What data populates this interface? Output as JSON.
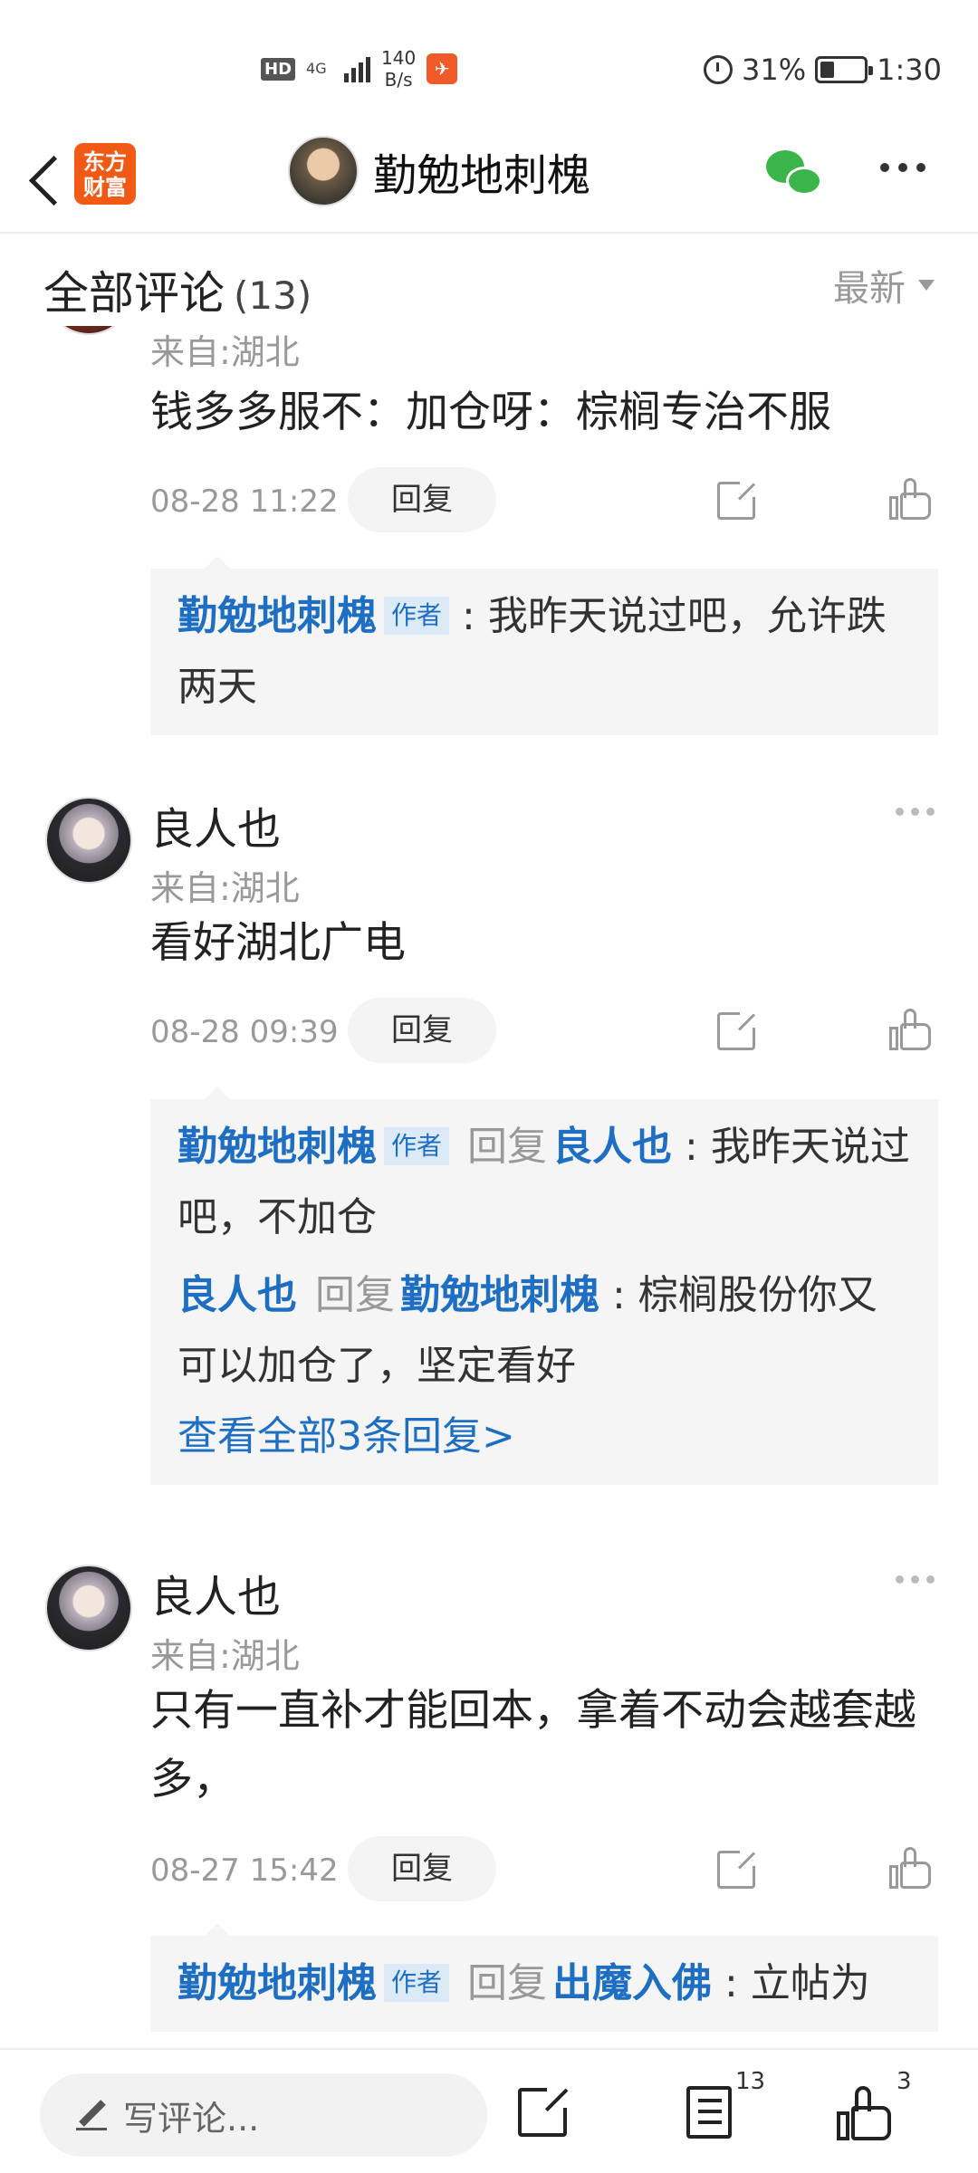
{
  "status_bar": {
    "hd": "HD",
    "network": "4G",
    "speed_value": "140",
    "speed_unit": "B/s",
    "battery": "31%",
    "time": "1:30"
  },
  "header": {
    "app_logo": "东方财富",
    "title": "勤勉地刺槐"
  },
  "comments_header": {
    "title": "全部评论",
    "count": "(13)",
    "sort": "最新"
  },
  "comments": [
    {
      "from": "来自:湖北",
      "text": "钱多多服不：加仓呀：棕榈专治不服",
      "time": "08-28 11:22",
      "reply_label": "回复",
      "replies": [
        {
          "name": "勤勉地刺槐",
          "tag": "作者",
          "text": ": 我昨天说过吧，允许跌两天"
        }
      ]
    },
    {
      "name": "良人也",
      "from": "来自:湖北",
      "text": "看好湖北广电",
      "time": "08-28 09:39",
      "reply_label": "回复",
      "replies": [
        {
          "name": "勤勉地刺槐",
          "tag": "作者",
          "reply_word": "回复",
          "target": "良人也",
          "text": ": 我昨天说过吧，不加仓"
        },
        {
          "name": "良人也",
          "reply_word": "回复",
          "target": "勤勉地刺槐",
          "text": ": 棕榈股份你又可以加仓了，坚定看好"
        }
      ],
      "view_all": "查看全部3条回复>"
    },
    {
      "name": "良人也",
      "from": "来自:湖北",
      "text": "只有一直补才能回本，拿着不动会越套越多，",
      "time": "08-27 15:42",
      "reply_label": "回复",
      "replies": [
        {
          "name": "勤勉地刺槐",
          "tag": "作者",
          "reply_word": "回复",
          "target": "出魔入佛",
          "text": ": 立帖为"
        }
      ]
    }
  ],
  "bottom_bar": {
    "placeholder": "写评论...",
    "comment_count": "13",
    "like_count": "3"
  },
  "colors": {
    "link_blue": "#1e6fc4",
    "brand_orange": "#f05a14",
    "wechat_green": "#3ab54a"
  }
}
